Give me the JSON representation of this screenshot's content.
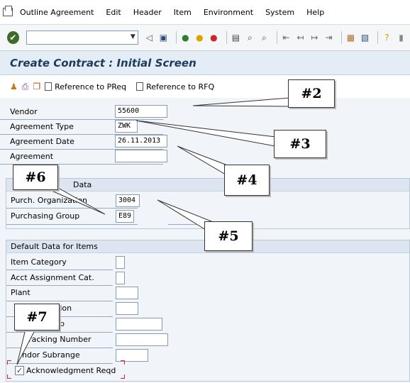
{
  "menu": {
    "items": [
      {
        "label": "Outline Agreement",
        "name": "menu-outline-agreement"
      },
      {
        "label": "Edit",
        "name": "menu-edit"
      },
      {
        "label": "Header",
        "name": "menu-header"
      },
      {
        "label": "Item",
        "name": "menu-item"
      },
      {
        "label": "Environment",
        "name": "menu-environment"
      },
      {
        "label": "System",
        "name": "menu-system"
      },
      {
        "label": "Help",
        "name": "menu-help"
      }
    ]
  },
  "toolbar": {
    "command_value": ""
  },
  "title": "Create Contract : Initial Screen",
  "app_toolbar": {
    "ref_preq": "Reference to PReq",
    "ref_rfq": "Reference to RFQ"
  },
  "form": {
    "vendor_label": "Vendor",
    "vendor_value": "55600",
    "agreement_type_label": "Agreement Type",
    "agreement_type_value": "ZWK",
    "agreement_date_label": "Agreement Date",
    "agreement_date_value": "26.11.2013",
    "agreement_label": "Agreement",
    "agreement_value": ""
  },
  "org_group": {
    "heading": "Data",
    "purch_org_label": "Purch. Organization",
    "purch_org_value": "3004",
    "purch_group_label": "Purchasing Group",
    "purch_group_value": "E89"
  },
  "items_group": {
    "heading": "Default Data for Items",
    "item_category_label": "Item Category",
    "acct_assignment_label": "Acct Assignment Cat.",
    "plant_label": "Plant",
    "storage_location_label": "tation",
    "material_group_label": "up",
    "tracking_label": "Tracking Number",
    "vendor_subrange_label": "ndor Subrange",
    "ack_label": "Acknowledgment Reqd",
    "ack_checked": true
  },
  "callouts": {
    "c2": "#2",
    "c3": "#3",
    "c4": "#4",
    "c5": "#5",
    "c6": "#6",
    "c7": "#7"
  }
}
